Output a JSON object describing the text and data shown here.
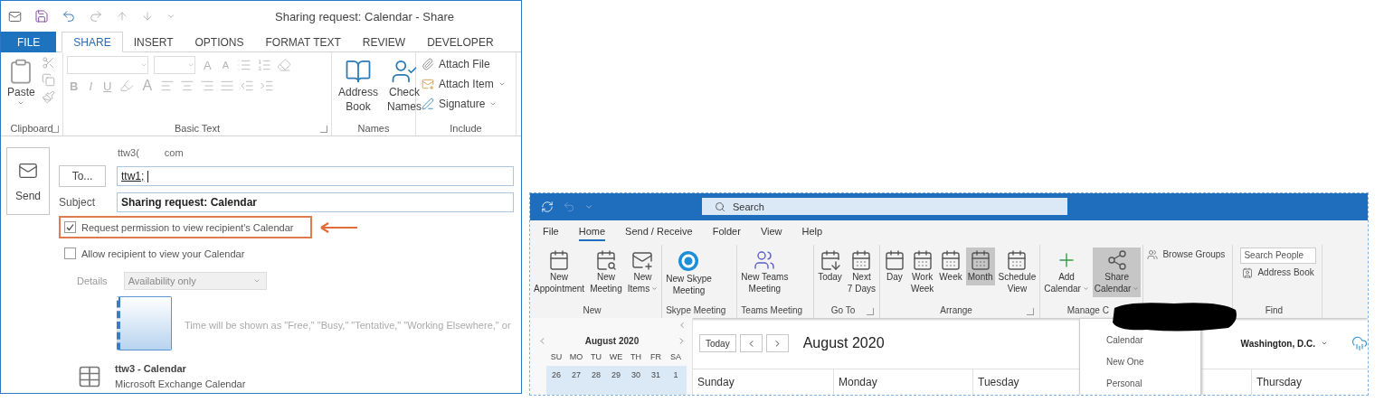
{
  "share_window": {
    "title": "Sharing request: Calendar - Share",
    "tabs": [
      {
        "label": "FILE",
        "kind": "file",
        "selected": false
      },
      {
        "label": "SHARE",
        "kind": "tab",
        "selected": true
      },
      {
        "label": "INSERT",
        "kind": "tab",
        "selected": false
      },
      {
        "label": "OPTIONS",
        "kind": "tab",
        "selected": false
      },
      {
        "label": "FORMAT TEXT",
        "kind": "tab",
        "selected": false
      },
      {
        "label": "REVIEW",
        "kind": "tab",
        "selected": false
      },
      {
        "label": "DEVELOPER",
        "kind": "tab",
        "selected": false
      }
    ],
    "ribbon_groups": [
      {
        "kind": "clipboard",
        "label": "Clipboard",
        "launcher": true,
        "buttons": [
          {
            "label": "Paste",
            "dropdown": true
          }
        ]
      },
      {
        "kind": "basic_text",
        "label": "Basic Text",
        "launcher": true,
        "disabled": true,
        "glyphs": {
          "grow": "A",
          "shrink": "A",
          "bold": "B",
          "italic": "I",
          "underline": "U",
          "font_color": "A"
        }
      },
      {
        "kind": "large",
        "label": "Names",
        "launcher": false,
        "buttons": [
          {
            "lines": [
              "Address",
              "Book"
            ]
          },
          {
            "lines": [
              "Check",
              "Names"
            ]
          }
        ]
      },
      {
        "kind": "small",
        "label": "Include",
        "launcher": false,
        "buttons": [
          {
            "label": "Attach File",
            "dropdown": false
          },
          {
            "label": "Attach Item",
            "dropdown": true
          },
          {
            "label": "Signature",
            "dropdown": true
          }
        ]
      }
    ],
    "send": "Send",
    "from_parts": [
      "ttw3(",
      "com"
    ],
    "to_button": "To...",
    "to_value": "ttw1;",
    "subject_label": "Subject",
    "subject_value": "Sharing request: Calendar",
    "options": [
      {
        "label": "Request permission to view recipient's Calendar",
        "checked": true,
        "highlighted": true
      },
      {
        "label": "Allow recipient to view your Calendar",
        "checked": false,
        "highlighted": false
      }
    ],
    "details": {
      "label": "Details",
      "value": "Availability only",
      "disabled": true
    },
    "preview_text": "Time will be shown as \"Free,\" \"Busy,\" \"Tentative,\" \"Working Elsewhere,\" or",
    "calendar": {
      "name": "ttw3 - Calendar",
      "type": "Microsoft Exchange Calendar"
    }
  },
  "calendar_window": {
    "search_placeholder": "Search",
    "tabs": [
      {
        "label": "File",
        "selected": false
      },
      {
        "label": "Home",
        "selected": true
      },
      {
        "label": "Send / Receive",
        "selected": false
      },
      {
        "label": "Folder",
        "selected": false
      },
      {
        "label": "View",
        "selected": false
      },
      {
        "label": "Help",
        "selected": false
      }
    ],
    "ribbon_groups": [
      {
        "kind": "large",
        "label": "New",
        "launcher": false,
        "buttons": [
          {
            "lines": [
              "New",
              "Appointment"
            ],
            "dropdown": false,
            "selected": false
          },
          {
            "lines": [
              "New",
              "Meeting"
            ],
            "dropdown": false,
            "selected": false
          },
          {
            "lines": [
              "New",
              "Items"
            ],
            "dropdown": true,
            "selected": false
          }
        ]
      },
      {
        "kind": "large",
        "label": "Skype Meeting",
        "launcher": false,
        "buttons": [
          {
            "lines": [
              "New Skype",
              "Meeting"
            ],
            "dropdown": false,
            "selected": false
          }
        ]
      },
      {
        "kind": "large",
        "label": "Teams Meeting",
        "launcher": false,
        "buttons": [
          {
            "lines": [
              "New Teams",
              "Meeting"
            ],
            "dropdown": false,
            "selected": false
          }
        ]
      },
      {
        "kind": "large",
        "label": "Go To",
        "launcher": true,
        "buttons": [
          {
            "lines": [
              "Today"
            ],
            "dropdown": false,
            "selected": false
          },
          {
            "lines": [
              "Next",
              "7 Days"
            ],
            "dropdown": false,
            "selected": false
          }
        ]
      },
      {
        "kind": "large",
        "label": "Arrange",
        "launcher": true,
        "buttons": [
          {
            "lines": [
              "Day"
            ],
            "dropdown": false,
            "selected": false
          },
          {
            "lines": [
              "Work",
              "Week"
            ],
            "dropdown": false,
            "selected": false
          },
          {
            "lines": [
              "Week"
            ],
            "dropdown": false,
            "selected": false
          },
          {
            "lines": [
              "Month"
            ],
            "dropdown": false,
            "selected": true
          },
          {
            "lines": [
              "Schedule",
              "View"
            ],
            "dropdown": false,
            "selected": false
          }
        ]
      },
      {
        "kind": "large",
        "label": "Manage C",
        "launcher": false,
        "buttons": [
          {
            "lines": [
              "Add",
              "Calendar"
            ],
            "dropdown": true,
            "selected": false
          },
          {
            "lines": [
              "Share",
              "Calendar"
            ],
            "dropdown": true,
            "selected": true
          }
        ]
      },
      {
        "kind": "small",
        "launcher": false,
        "buttons": [
          {
            "label": "Browse Groups"
          }
        ]
      },
      {
        "kind": "find",
        "label": "Find",
        "launcher": false,
        "placeholder": "Search People",
        "buttons": [
          {
            "label": "Address Book"
          }
        ]
      }
    ],
    "share_menu": [
      "Calendar",
      "New One",
      "Personal"
    ],
    "mini_calendar": {
      "title": "August 2020",
      "weekdays": [
        "SU",
        "MO",
        "TU",
        "WE",
        "TH",
        "FR",
        "SA"
      ],
      "days": [
        "26",
        "27",
        "28",
        "29",
        "30",
        "31",
        "1"
      ]
    },
    "today_button": "Today",
    "month_title": "August 2020",
    "location": "Washington, D.C.",
    "day_columns": [
      "Sunday",
      "Monday",
      "Tuesday",
      "Thursday"
    ]
  }
}
